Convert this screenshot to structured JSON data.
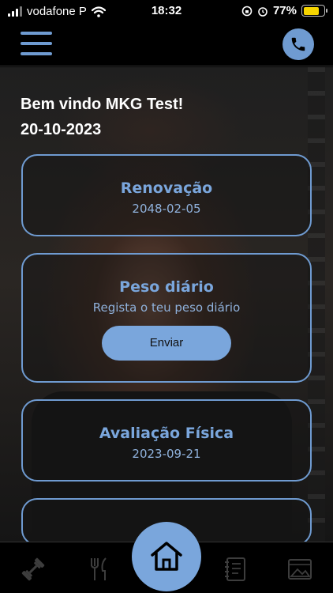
{
  "status_bar": {
    "carrier": "vodafone P",
    "time": "18:32",
    "battery": "77%"
  },
  "welcome": {
    "greeting": "Bem vindo MKG Test!",
    "date": "20-10-2023"
  },
  "cards": [
    {
      "title": "Renovação",
      "subtitle": "2048-02-05"
    },
    {
      "title": "Peso diário",
      "subtitle": "Regista o teu peso diário",
      "button": "Enviar"
    },
    {
      "title": "Avaliação Física",
      "subtitle": "2023-09-21"
    }
  ],
  "colors": {
    "accent": "#7aa6dc",
    "background": "#000000",
    "battery": "#f5d400"
  },
  "bottom_nav": {
    "items": [
      "dumbbell-icon",
      "utensils-icon",
      "home-icon",
      "notebook-icon",
      "gallery-icon"
    ]
  }
}
